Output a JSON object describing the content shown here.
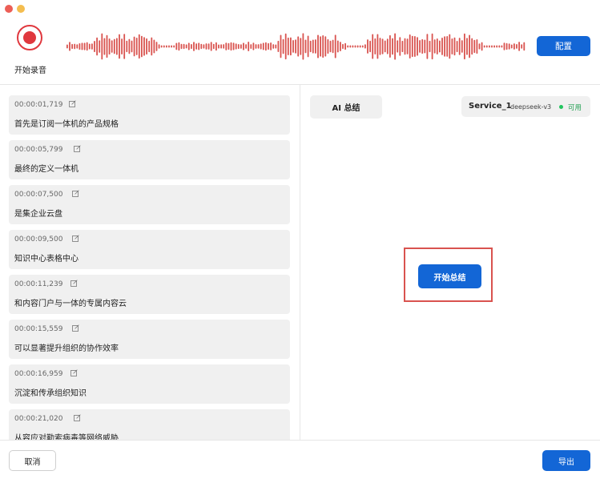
{
  "header": {
    "record_label": "开始录音",
    "config_label": "配置"
  },
  "transcript": {
    "items": [
      {
        "timestamp": "00:00:01,719",
        "text": "首先是订阅一体机的产品规格"
      },
      {
        "timestamp": "00:00:05,799",
        "text": "最终的定义一体机"
      },
      {
        "timestamp": "00:00:07,500",
        "text": "是集企业云盘"
      },
      {
        "timestamp": "00:00:09,500",
        "text": "知识中心表格中心"
      },
      {
        "timestamp": "00:00:11,239",
        "text": "和内容门户与一体的专属内容云"
      },
      {
        "timestamp": "00:00:15,559",
        "text": "可以显著提升组织的协作效率"
      },
      {
        "timestamp": "00:00:16,959",
        "text": "沉淀和传承组织知识"
      },
      {
        "timestamp": "00:00:21,020",
        "text": "从容应对勒索病毒等网络威胁"
      }
    ]
  },
  "right_panel": {
    "tab_label": "AI 总结",
    "service_name": "Service_1",
    "service_model": "deepseek-v3",
    "service_status": "可用",
    "start_label": "开始总结"
  },
  "footer": {
    "cancel_label": "取消",
    "export_label": "导出"
  },
  "colors": {
    "accent": "#1366d6",
    "record": "#e0383e",
    "status_ok": "#22c55e"
  }
}
